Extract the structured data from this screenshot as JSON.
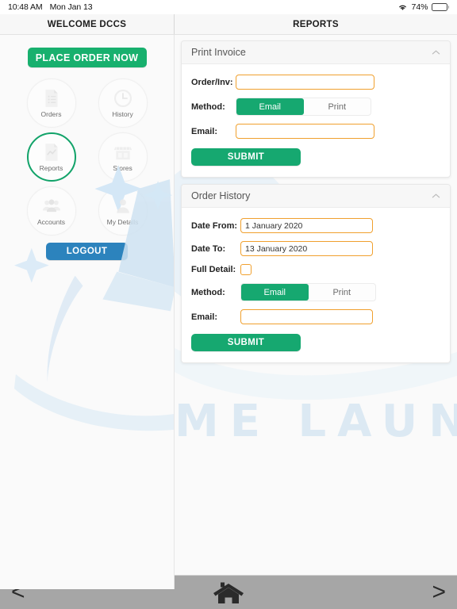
{
  "status_bar": {
    "time": "10:48 AM",
    "date": "Mon Jan 13",
    "battery_percent": "74%",
    "wifi_icon": "wifi-icon",
    "battery_icon": "battery-icon"
  },
  "panes": {
    "left_title": "WELCOME DCCS",
    "right_title": "REPORTS"
  },
  "sidebar": {
    "place_order_label": "PLACE ORDER NOW",
    "logout_label": "LOGOUT",
    "items": [
      {
        "label": "Orders",
        "icon": "document-list-icon",
        "active": false
      },
      {
        "label": "History",
        "icon": "clock-icon",
        "active": false
      },
      {
        "label": "Reports",
        "icon": "report-chart-icon",
        "active": true
      },
      {
        "label": "Stores",
        "icon": "storefront-icon",
        "active": false
      },
      {
        "label": "Accounts",
        "icon": "people-group-icon",
        "active": false
      },
      {
        "label": "My Details",
        "icon": "person-icon",
        "active": false
      }
    ]
  },
  "watermark": "ME LAUNDRY",
  "cards": [
    {
      "title": "Print Invoice",
      "collapse_icon": "chevron-up-icon",
      "order_label": "Order/Inv:",
      "order_value": "",
      "order_placeholder": "",
      "method_label": "Method:",
      "method_options": [
        "Email",
        "Print"
      ],
      "method_selected": "Email",
      "email_label": "Email:",
      "email_value": "",
      "email_placeholder": "",
      "submit_label": "SUBMIT"
    },
    {
      "title": "Order History",
      "collapse_icon": "chevron-up-icon",
      "date_from_label": "Date From:",
      "date_from_value": "1 January 2020",
      "date_to_label": "Date To:",
      "date_to_value": "13 January 2020",
      "full_detail_label": "Full Detail:",
      "full_detail_checked": false,
      "method_label": "Method:",
      "method_options": [
        "Email",
        "Print"
      ],
      "method_selected": "Email",
      "email_label": "Email:",
      "email_value": "",
      "email_placeholder": "",
      "submit_label": "SUBMIT"
    }
  ],
  "bottom_nav": {
    "back_label": "<",
    "forward_label": ">",
    "home_icon": "home-icon"
  },
  "colors": {
    "green": "#16a870",
    "green_button": "#18b06e",
    "blue": "#2c83bd",
    "orange_border": "#f0a02e",
    "watermark_blue": "#dce9f3",
    "bottom_bar_gray": "#a6a6a6"
  }
}
